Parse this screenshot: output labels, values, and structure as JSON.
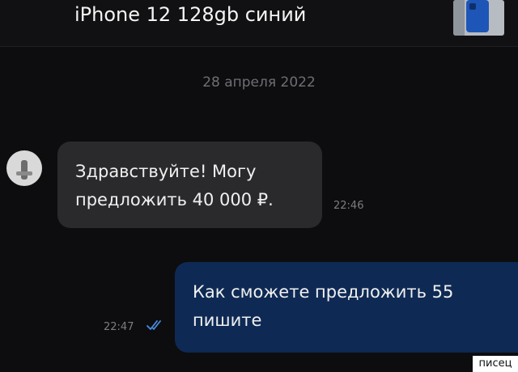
{
  "ad": {
    "title": "iPhone 12 128gb синий",
    "thumbnail_icon": "phone-photo"
  },
  "chat": {
    "date_separator": "28 апреля 2022",
    "messages": [
      {
        "direction": "incoming",
        "lines": [
          "Здравствуйте! Могу",
          "предложить 40 000 ₽."
        ],
        "time": "22:46"
      },
      {
        "direction": "outgoing",
        "lines": [
          "Как сможете предложить 55",
          "пишите"
        ],
        "time": "22:47",
        "status_icon": "double-check-icon",
        "status_color": "#4a8de0"
      }
    ]
  },
  "watermark": "писец",
  "colors": {
    "background": "#0d0d0f",
    "incoming_bubble": "#2a2a2d",
    "outgoing_bubble": "#0e2a54"
  }
}
